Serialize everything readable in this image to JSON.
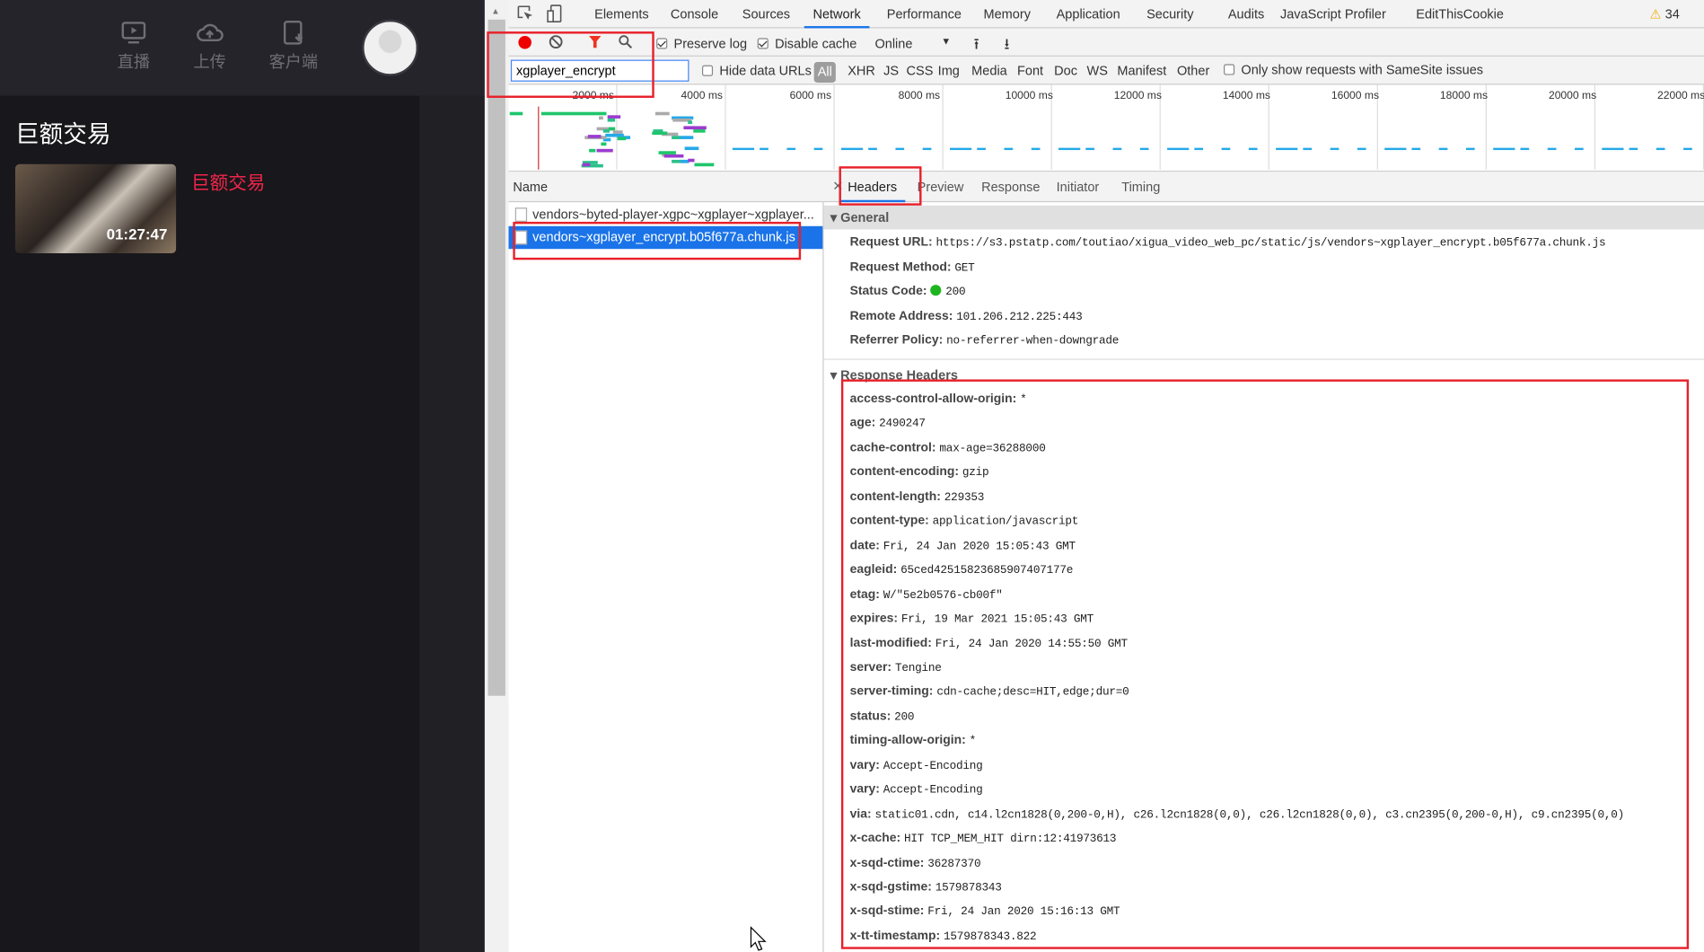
{
  "site": {
    "nav": [
      {
        "label": "直播",
        "icon": "live-tv-icon"
      },
      {
        "label": "上传",
        "icon": "cloud-upload-icon"
      },
      {
        "label": "客户端",
        "icon": "client-download-icon"
      }
    ],
    "page_title": "巨额交易",
    "video": {
      "title": "巨额交易",
      "duration": "01:27:47"
    },
    "accent": "#f2254b"
  },
  "devtools": {
    "tabs": [
      "Elements",
      "Console",
      "Sources",
      "Network",
      "Performance",
      "Memory",
      "Application",
      "Security",
      "Audits",
      "JavaScript Profiler",
      "EditThisCookie"
    ],
    "active_tab": "Network",
    "warnings": "34",
    "toolbar": {
      "preserve_log": "Preserve log",
      "preserve_log_checked": true,
      "disable_cache": "Disable cache",
      "disable_cache_checked": true,
      "throttle": "Online"
    },
    "filter": {
      "value": "xgplayer_encrypt",
      "hide_data_urls": "Hide data URLs",
      "types": [
        "All",
        "XHR",
        "JS",
        "CSS",
        "Img",
        "Media",
        "Font",
        "Doc",
        "WS",
        "Manifest",
        "Other"
      ],
      "active_type": "All",
      "samesite": "Only show requests with SameSite issues"
    },
    "timeline_ticks": [
      "2000 ms",
      "4000 ms",
      "6000 ms",
      "8000 ms",
      "10000 ms",
      "12000 ms",
      "14000 ms",
      "16000 ms",
      "18000 ms",
      "20000 ms",
      "22000 ms"
    ],
    "name_header": "Name",
    "requests": [
      {
        "name": "vendors~byted-player-xgpc~xgplayer~xgplayer...",
        "selected": false
      },
      {
        "name": "vendors~xgplayer_encrypt.b05f677a.chunk.js",
        "selected": true
      }
    ],
    "detail_tabs": [
      "Headers",
      "Preview",
      "Response",
      "Initiator",
      "Timing"
    ],
    "active_detail_tab": "Headers",
    "general_title": "General",
    "general": [
      {
        "k": "Request URL:",
        "v": "https://s3.pstatp.com/toutiao/xigua_video_web_pc/static/js/vendors~xgplayer_encrypt.b05f677a.chunk.js"
      },
      {
        "k": "Request Method:",
        "v": "GET"
      },
      {
        "k": "Status Code:",
        "v": "200"
      },
      {
        "k": "Remote Address:",
        "v": "101.206.212.225:443"
      },
      {
        "k": "Referrer Policy:",
        "v": "no-referrer-when-downgrade"
      }
    ],
    "response_title": "Response Headers",
    "response": [
      {
        "k": "access-control-allow-origin:",
        "v": "*"
      },
      {
        "k": "age:",
        "v": "2490247"
      },
      {
        "k": "cache-control:",
        "v": "max-age=36288000"
      },
      {
        "k": "content-encoding:",
        "v": "gzip"
      },
      {
        "k": "content-length:",
        "v": "229353"
      },
      {
        "k": "content-type:",
        "v": "application/javascript"
      },
      {
        "k": "date:",
        "v": "Fri, 24 Jan 2020 15:05:43 GMT"
      },
      {
        "k": "eagleid:",
        "v": "65ced42515823685907407177e"
      },
      {
        "k": "etag:",
        "v": "W/\"5e2b0576-cb00f\""
      },
      {
        "k": "expires:",
        "v": "Fri, 19 Mar 2021 15:05:43 GMT"
      },
      {
        "k": "last-modified:",
        "v": "Fri, 24 Jan 2020 14:55:50 GMT"
      },
      {
        "k": "server:",
        "v": "Tengine"
      },
      {
        "k": "server-timing:",
        "v": "cdn-cache;desc=HIT,edge;dur=0"
      },
      {
        "k": "status:",
        "v": "200"
      },
      {
        "k": "timing-allow-origin:",
        "v": "*"
      },
      {
        "k": "vary:",
        "v": "Accept-Encoding"
      },
      {
        "k": "vary:",
        "v": "Accept-Encoding"
      },
      {
        "k": "via:",
        "v": "static01.cdn, c14.l2cn1828(0,200-0,H), c26.l2cn1828(0,0), c26.l2cn1828(0,0), c3.cn2395(0,200-0,H), c9.cn2395(0,0)"
      },
      {
        "k": "x-cache:",
        "v": "HIT TCP_MEM_HIT dirn:12:41973613"
      },
      {
        "k": "x-sqd-ctime:",
        "v": "36287370"
      },
      {
        "k": "x-sqd-gstime:",
        "v": "1579878343"
      },
      {
        "k": "x-sqd-stime:",
        "v": "Fri, 24 Jan 2020 15:16:13 GMT"
      },
      {
        "k": "x-tt-timestamp:",
        "v": "1579878343.822"
      }
    ],
    "status_ok_color": "#1eb61e",
    "highlight_color": "#e8202a"
  }
}
